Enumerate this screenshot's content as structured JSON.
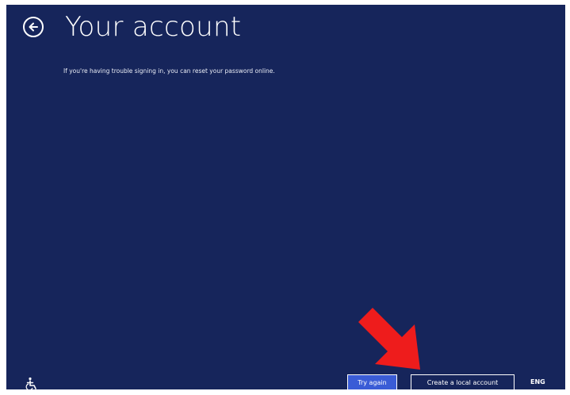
{
  "header": {
    "back_icon": "back-arrow-circle-icon",
    "title": "Your account"
  },
  "main": {
    "help_text": "If you're having trouble signing in, you can reset your password online."
  },
  "footer": {
    "ease_of_access_icon": "ease-of-access-icon",
    "try_again_label": "Try again",
    "create_local_label": "Create a local account",
    "language": "ENG"
  },
  "annotation": {
    "arrow_icon": "red-arrow-icon",
    "arrow_color": "#ee1c1c"
  },
  "colors": {
    "background": "#16255b",
    "accent_button": "#3a5cd6",
    "text": "#ffffff"
  }
}
